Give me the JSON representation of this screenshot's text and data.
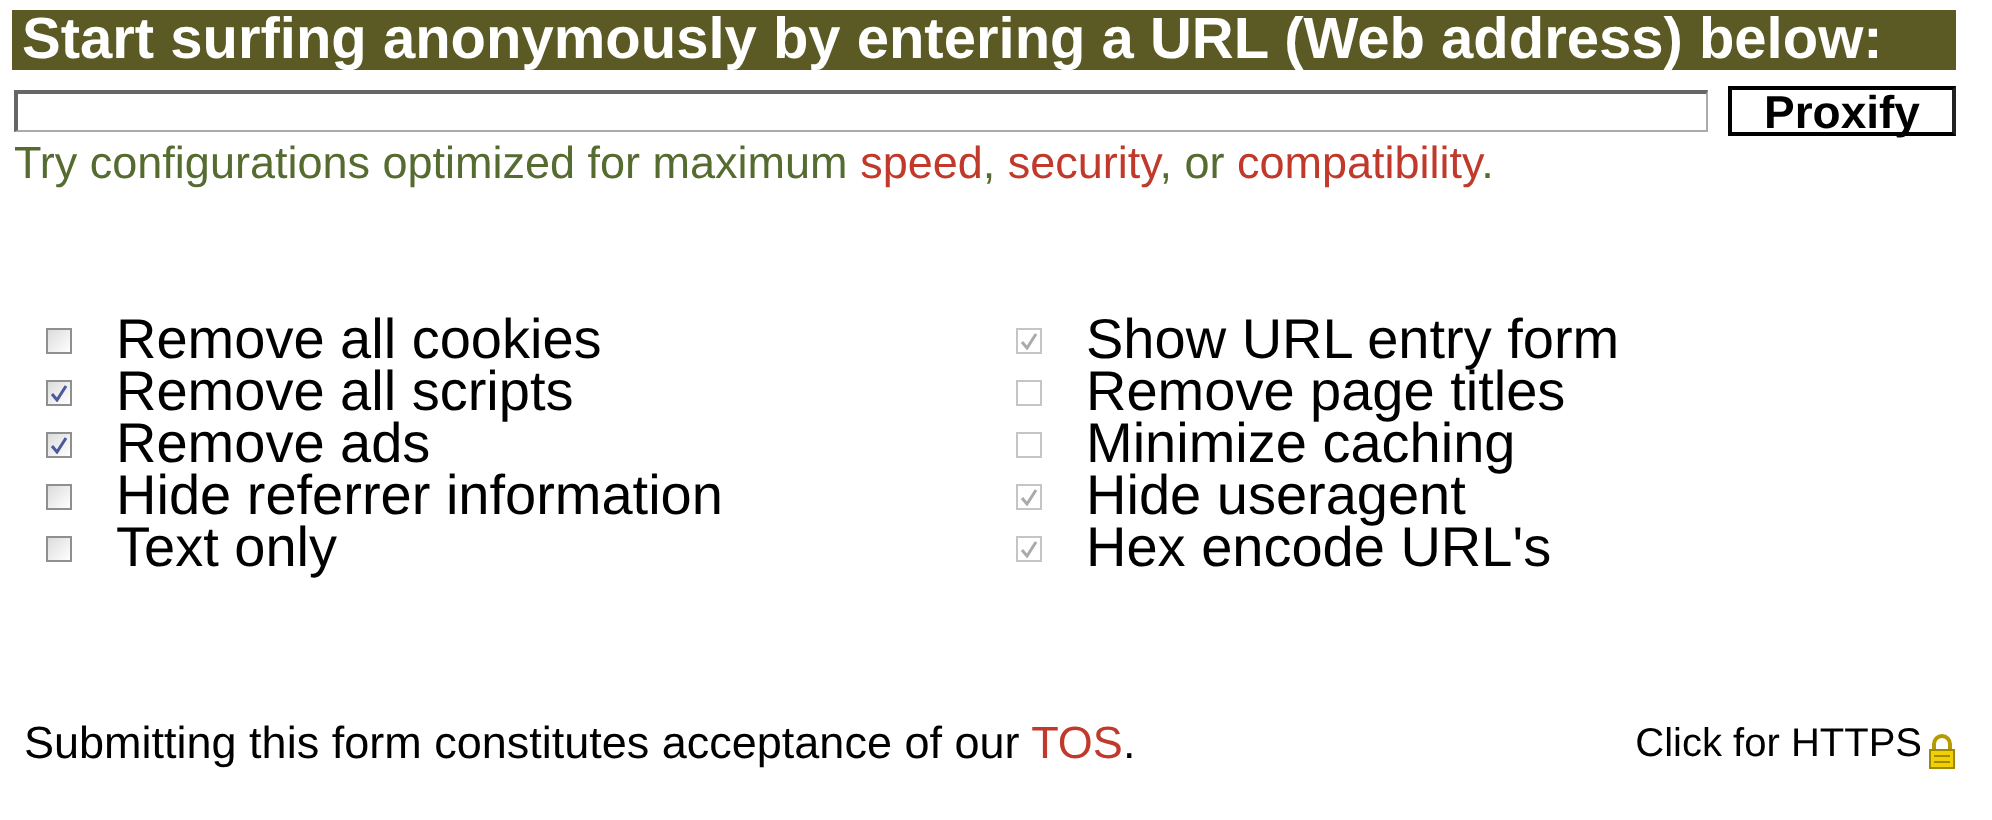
{
  "header": {
    "title": "Start surfing anonymously by entering a URL (Web address) below:"
  },
  "url_form": {
    "button": "Proxify"
  },
  "hint": {
    "text": "Try configurations optimized for maximum ",
    "links": [
      {
        "label": "speed",
        "after": ", "
      },
      {
        "label": "security",
        "after": ", or "
      },
      {
        "label": "compatibility",
        "after": "."
      }
    ]
  },
  "options_left": [
    {
      "label": "Remove all cookies",
      "checked": false,
      "disabled": false
    },
    {
      "label": "Remove all scripts",
      "checked": true,
      "disabled": false
    },
    {
      "label": "Remove ads",
      "checked": true,
      "disabled": false
    },
    {
      "label": "Hide referrer information",
      "checked": false,
      "disabled": false
    },
    {
      "label": "Text only",
      "checked": false,
      "disabled": false
    }
  ],
  "options_right": [
    {
      "label": "Show URL entry form",
      "checked": true,
      "disabled": true
    },
    {
      "label": "Remove page titles",
      "checked": false,
      "disabled": true
    },
    {
      "label": "Minimize caching",
      "checked": false,
      "disabled": true
    },
    {
      "label": "Hide useragent",
      "checked": true,
      "disabled": true
    },
    {
      "label": "Hex encode URL's",
      "checked": true,
      "disabled": true
    }
  ],
  "footer": {
    "text": "Submitting this form constitutes acceptance of our ",
    "link": "TOS",
    "after": ".",
    "https_link": "Click for HTTPS"
  }
}
